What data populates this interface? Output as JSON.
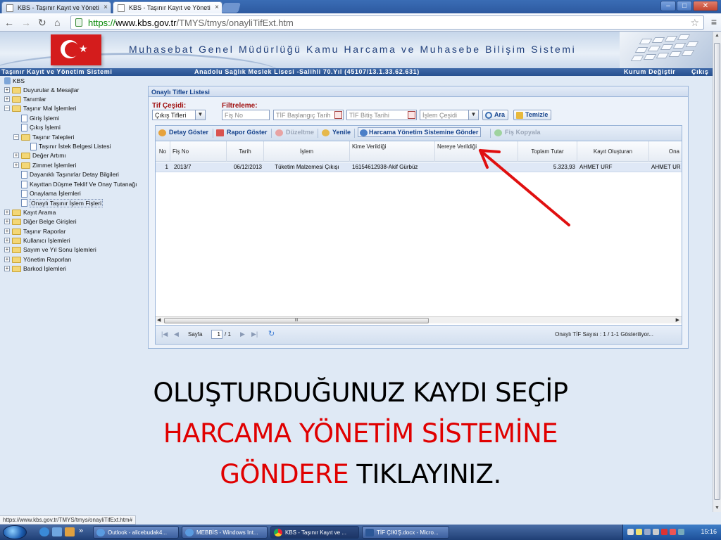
{
  "browser": {
    "tabs": [
      {
        "title": "KBS - Taşınır Kayıt ve Yöneti",
        "close": "×"
      },
      {
        "title": "KBS - Taşınır Kayıt ve Yöneti",
        "close": "×"
      }
    ],
    "window_controls": {
      "minimize": "–",
      "maximize": "□",
      "close": "✕"
    },
    "url": {
      "scheme": "https://",
      "host": "www.kbs.gov.tr",
      "path": "/TMYS/tmys/onayliTifExt.htm"
    },
    "status_url": "https://www.kbs.gov.tr/TMYS/tmys/onayliTifExt.htm#"
  },
  "banner": {
    "title": "Muhasebat Genel Müdürlüğü Kamu Harcama ve Muhasebe Bilişim Sistemi"
  },
  "appbar": {
    "system_name": "Taşınır Kayıt ve Yönetim Sistemi",
    "institution": "Anadolu Sağlık Meslek Lisesi -Salihli 70.Yıl (45107/13.1.33.62.631)",
    "change_institution": "Kurum Değiştir",
    "logout": "Çıkış"
  },
  "tree": {
    "root": "KBS",
    "items": [
      {
        "label": "Duyurular & Mesajlar",
        "level": 0,
        "kind": "folder",
        "expander": "+"
      },
      {
        "label": "Tanımlar",
        "level": 0,
        "kind": "folder",
        "expander": "+"
      },
      {
        "label": "Taşınır Mal İşlemleri",
        "level": 0,
        "kind": "folder",
        "expander": "–"
      },
      {
        "label": "Giriş İşlemi",
        "level": 1,
        "kind": "doc"
      },
      {
        "label": "Çıkış İşlemi",
        "level": 1,
        "kind": "doc"
      },
      {
        "label": "Taşınır Talepleri",
        "level": 1,
        "kind": "folder",
        "expander": "–"
      },
      {
        "label": "Taşınır İstek Belgesi Listesi",
        "level": 2,
        "kind": "doc"
      },
      {
        "label": "Değer Artımı",
        "level": 1,
        "kind": "folder",
        "expander": "+"
      },
      {
        "label": "Zimmet İşlemleri",
        "level": 1,
        "kind": "folder",
        "expander": "+"
      },
      {
        "label": "Dayanıklı Taşınırlar Detay Bilgileri",
        "level": 1,
        "kind": "doc"
      },
      {
        "label": "Kayıttan Düşme Teklif Ve Onay Tutanağı",
        "level": 1,
        "kind": "doc"
      },
      {
        "label": "Onaylama İşlemleri",
        "level": 1,
        "kind": "doc"
      },
      {
        "label": "Onaylı Taşınır İşlem Fişleri",
        "level": 1,
        "kind": "doc",
        "selected": true
      },
      {
        "label": "Kayıt Arama",
        "level": 0,
        "kind": "folder",
        "expander": "+"
      },
      {
        "label": "Diğer Belge Girişleri",
        "level": 0,
        "kind": "folder",
        "expander": "+"
      },
      {
        "label": "Taşınır Raporlar",
        "level": 0,
        "kind": "folder",
        "expander": "+"
      },
      {
        "label": "Kullanıcı İşlemleri",
        "level": 0,
        "kind": "folder",
        "expander": "+"
      },
      {
        "label": "Sayım ve Yıl Sonu İşlemleri",
        "level": 0,
        "kind": "folder",
        "expander": "+"
      },
      {
        "label": "Yönetim Raporları",
        "level": 0,
        "kind": "folder",
        "expander": "+"
      },
      {
        "label": "Barkod İşlemleri",
        "level": 0,
        "kind": "folder",
        "expander": "+"
      }
    ]
  },
  "panel": {
    "title": "Onaylı Tifler Listesi",
    "tif_type_label": "Tif Çeşidi:",
    "tif_type_value": "Çıkış Tifleri",
    "filter_label": "Filtreleme:",
    "fis_no_placeholder": "Fiş No",
    "start_date_placeholder": "TİF Başlangıç Tarih",
    "end_date_placeholder": "TİF Bitiş Tarihi",
    "operation_type_placeholder": "İşlem Çeşidi",
    "search_button": "Ara",
    "clear_button": "Temizle"
  },
  "toolbar": {
    "detail": "Detay Göster",
    "report": "Rapor Göster",
    "edit": "Düzeltme",
    "refresh": "Yenile",
    "send_to_hys": "Harcama Yönetim Sistemine Gönder",
    "copy": "Fiş Kopyala"
  },
  "table": {
    "columns": [
      "No",
      "Fiş No",
      "Tarih",
      "İşlem",
      "Kime Verildiği",
      "Nereye Verildiği",
      "Toplam Tutar",
      "Kayıt Oluşturan",
      "Ona"
    ],
    "rows": [
      [
        "1",
        "2013/7",
        "06/12/2013",
        "Tüketim Malzemesi Çıkışı",
        "16154612938-Akif Gürbüz",
        "",
        "5.323,93",
        "AHMET URF",
        "AHMET UR"
      ]
    ]
  },
  "scroll_grip": "III",
  "pager": {
    "page_label": "Sayfa",
    "page_value": "1",
    "page_total": "/ 1",
    "summary": "Onaylı TİF Sayısı : 1 / 1-1 Gösteriliyor..."
  },
  "instruction": {
    "line1": "OLUŞTURDUĞUNUZ KAYDI SEÇİP",
    "line2": "HARCAMA YÖNETİM SİSTEMİNE",
    "line3_red": "GÖNDERE",
    "line3_black": "TIKLAYINIZ."
  },
  "taskbar": {
    "tasks": [
      "Outlook - alicebudak4...",
      "MEBBİS - Windows Int...",
      "KBS - Taşınır Kayıt ve ...",
      "TİF ÇIKIŞ.docx - Micro..."
    ],
    "overflow": "»",
    "clock": "15:16"
  },
  "colors": {
    "accent_blue": "#15428b",
    "instruction_red": "#e00000",
    "appbar_blue": "#2d5aa0",
    "arrow_red": "#e01010"
  }
}
